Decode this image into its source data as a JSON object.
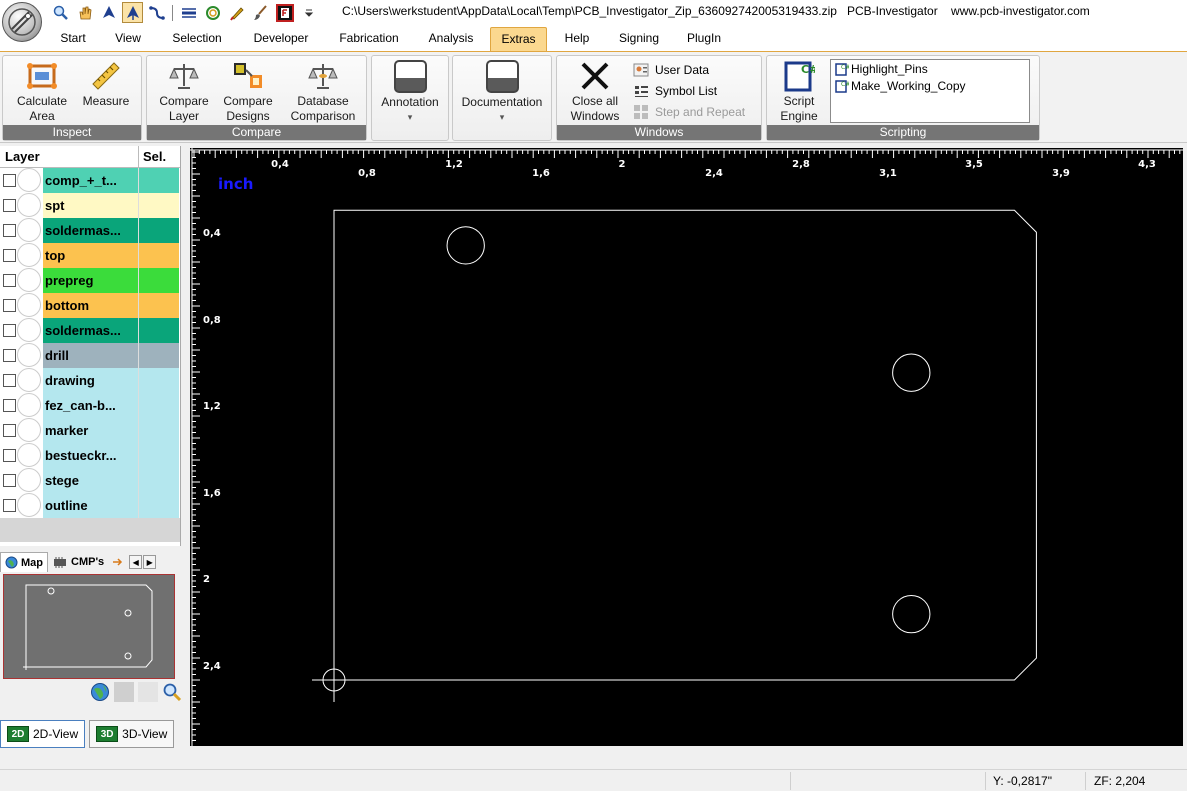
{
  "titlebar": {
    "path": "C:\\Users\\werkstudent\\AppData\\Local\\Temp\\PCB_Investigator_Zip_636092742005319433.zip",
    "app_name": "PCB-Investigator",
    "website": "www.pcb-investigator.com",
    "qat_icons": [
      "zoom-icon",
      "hand-icon",
      "arrow-up-icon",
      "select-arrow-icon",
      "route-icon",
      "measure-bar-icon",
      "circle-icon",
      "pen-icon",
      "brush-icon",
      "frame-icon",
      "dropdown-icon"
    ]
  },
  "tabs": [
    {
      "label": "Start"
    },
    {
      "label": "View"
    },
    {
      "label": "Selection"
    },
    {
      "label": "Developer"
    },
    {
      "label": "Fabrication"
    },
    {
      "label": "Analysis"
    },
    {
      "label": "Extras"
    },
    {
      "label": "Help"
    },
    {
      "label": "Signing"
    },
    {
      "label": "PlugIn"
    }
  ],
  "active_tab": "Extras",
  "ribbon": {
    "inspect": {
      "label": "Inspect",
      "calc_line1": "Calculate",
      "calc_line2": "Area",
      "measure": "Measure"
    },
    "compare": {
      "label": "Compare",
      "layer_line1": "Compare",
      "layer_line2": "Layer",
      "designs_line1": "Compare",
      "designs_line2": "Designs",
      "db_line1": "Database",
      "db_line2": "Comparison"
    },
    "annotation": {
      "label": "Annotation"
    },
    "documentation": {
      "label": "Documentation"
    },
    "windows": {
      "label": "Windows",
      "close_line1": "Close all",
      "close_line2": "Windows",
      "user_data": "User Data",
      "symbol_list": "Symbol List",
      "step_repeat": "Step and Repeat"
    },
    "scripting": {
      "label": "Scripting",
      "engine_line1": "Script",
      "engine_line2": "Engine",
      "scripts": [
        "Highlight_Pins",
        "Make_Working_Copy"
      ]
    }
  },
  "layers": {
    "header_layer": "Layer",
    "header_sel": "Sel.",
    "items": [
      {
        "name": "comp_+_t...",
        "color": "#4fd1b3"
      },
      {
        "name": "spt",
        "color": "#fff9c4"
      },
      {
        "name": "soldermas...",
        "color": "#0aa57a"
      },
      {
        "name": "top",
        "color": "#fcc24f"
      },
      {
        "name": "prepreg",
        "color": "#3bdc3b"
      },
      {
        "name": "bottom",
        "color": "#fcc24f"
      },
      {
        "name": "soldermas...",
        "color": "#0aa57a"
      },
      {
        "name": "drill",
        "color": "#9eb2bd"
      },
      {
        "name": "drawing",
        "color": "#b4e7ee"
      },
      {
        "name": "fez_can-b...",
        "color": "#b4e7ee"
      },
      {
        "name": "marker",
        "color": "#b4e7ee"
      },
      {
        "name": "bestueckr...",
        "color": "#b4e7ee"
      },
      {
        "name": "stege",
        "color": "#b4e7ee"
      },
      {
        "name": "outline",
        "color": "#b4e7ee"
      }
    ]
  },
  "map_panel": {
    "tab_map": "Map",
    "tab_cmps": "CMP's",
    "tools": [
      "globe-icon",
      "blank-icon",
      "magnifier-icon"
    ]
  },
  "view_buttons": {
    "btn_2d": "2D-View",
    "btn_2d_icon": "2D",
    "btn_3d": "3D-View",
    "btn_3d_icon": "3D"
  },
  "canvas": {
    "unit_label": "inch",
    "x_ticks": [
      0.4,
      0.8,
      1.2,
      1.6,
      2,
      2.4,
      2.8,
      3.1,
      3.5,
      3.9,
      4.3
    ],
    "y_ticks": [
      0.4,
      0.8,
      1.2,
      1.6,
      2,
      2.4
    ],
    "board_outline": {
      "xmin": 0.0,
      "xmax": 3.2,
      "ymin": 0.0,
      "ymax": 2.14,
      "chamfer": 0.1
    },
    "holes": [
      {
        "x": 0.6,
        "y": 1.98,
        "d": 0.17
      },
      {
        "x": 2.63,
        "y": 1.4,
        "d": 0.17
      },
      {
        "x": 2.63,
        "y": 0.3,
        "d": 0.17
      }
    ],
    "colors": {
      "background": "#000000",
      "outline": "#ffffff",
      "ruler": "#ffffff",
      "unit_label": "#1a1aff"
    }
  },
  "statusbar": {
    "y_readout": "Y: -0,2817\"",
    "zoom_factor": "ZF: 2,204"
  }
}
